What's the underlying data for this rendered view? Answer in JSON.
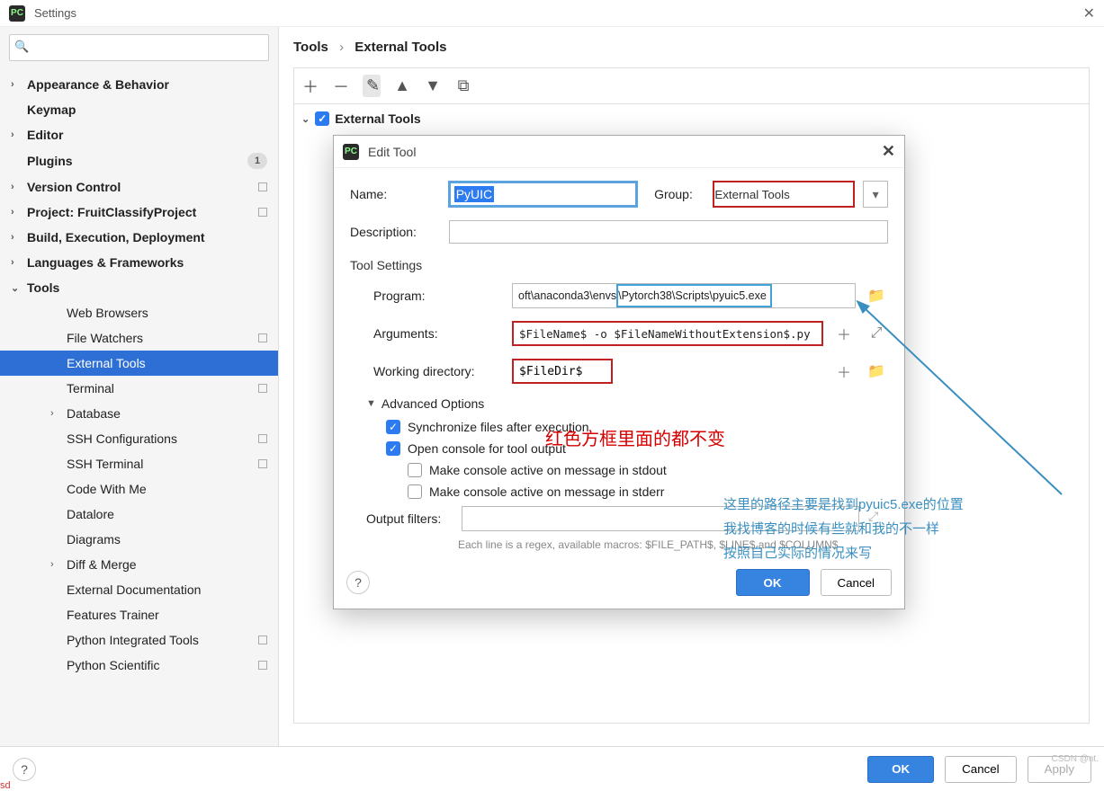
{
  "window": {
    "title": "Settings"
  },
  "breadcrumb": {
    "root": "Tools",
    "leaf": "External Tools"
  },
  "sidebar": {
    "search_placeholder": "",
    "items": [
      {
        "label": "Appearance & Behavior",
        "chev": "›",
        "top": true
      },
      {
        "label": "Keymap",
        "chev": "",
        "top": true
      },
      {
        "label": "Editor",
        "chev": "›",
        "top": true
      },
      {
        "label": "Plugins",
        "chev": "",
        "top": true,
        "badge": "1"
      },
      {
        "label": "Version Control",
        "chev": "›",
        "top": true,
        "square": true
      },
      {
        "label": "Project: FruitClassifyProject",
        "chev": "›",
        "top": true,
        "square": true
      },
      {
        "label": "Build, Execution, Deployment",
        "chev": "›",
        "top": true
      },
      {
        "label": "Languages & Frameworks",
        "chev": "›",
        "top": true
      },
      {
        "label": "Tools",
        "chev": "⌄",
        "top": true
      },
      {
        "label": "Web Browsers",
        "sub": true
      },
      {
        "label": "File Watchers",
        "sub": true,
        "square": true
      },
      {
        "label": "External Tools",
        "sub": true,
        "selected": true
      },
      {
        "label": "Terminal",
        "sub": true,
        "square": true
      },
      {
        "label": "Database",
        "sub": true,
        "chev": "›"
      },
      {
        "label": "SSH Configurations",
        "sub": true,
        "square": true
      },
      {
        "label": "SSH Terminal",
        "sub": true,
        "square": true
      },
      {
        "label": "Code With Me",
        "sub": true
      },
      {
        "label": "Datalore",
        "sub": true
      },
      {
        "label": "Diagrams",
        "sub": true
      },
      {
        "label": "Diff & Merge",
        "sub": true,
        "chev": "›"
      },
      {
        "label": "External Documentation",
        "sub": true
      },
      {
        "label": "Features Trainer",
        "sub": true
      },
      {
        "label": "Python Integrated Tools",
        "sub": true,
        "square": true
      },
      {
        "label": "Python Scientific",
        "sub": true,
        "square": true
      }
    ]
  },
  "ext_tree": {
    "root": "External Tools",
    "checked": true
  },
  "dialog": {
    "title": "Edit Tool",
    "labels": {
      "name": "Name:",
      "group": "Group:",
      "description": "Description:",
      "tool_settings": "Tool Settings",
      "program": "Program:",
      "arguments": "Arguments:",
      "working_dir": "Working directory:",
      "advanced": "Advanced Options",
      "output_filters": "Output filters:"
    },
    "fields": {
      "name": "PyUIC",
      "group": "External Tools",
      "description": "",
      "program_prefix": "oft\\anaconda3\\envs",
      "program_highlight": "\\Pytorch38\\Scripts\\pyuic5.exe",
      "arguments": "$FileName$ -o $FileNameWithoutExtension$.py",
      "working_dir": "$FileDir$",
      "output_filters": ""
    },
    "options": {
      "sync": "Synchronize files after execution",
      "open_console": "Open console for tool output",
      "active_stdout": "Make console active on message in stdout",
      "active_stderr": "Make console active on message in stderr"
    },
    "hint": "Each line is a regex, available macros: $FILE_PATH$, $LINE$ and $COLUMN$",
    "buttons": {
      "ok": "OK",
      "cancel": "Cancel"
    }
  },
  "footer": {
    "ok": "OK",
    "cancel": "Cancel",
    "apply": "Apply"
  },
  "annotations": {
    "red": "红色方框里面的都不变",
    "blue1": "这里的路径主要是找到pyuic5.exe的位置",
    "blue2": "我找博客的时候有些就和我的不一样",
    "blue3": "按照自己实际的情况来写"
  },
  "watermark": "CSDN @nt.",
  "sd": "sd"
}
